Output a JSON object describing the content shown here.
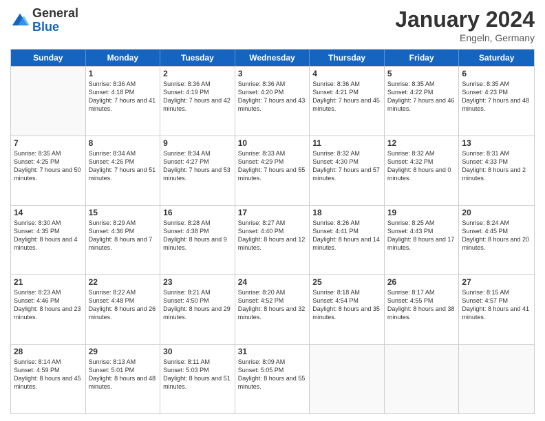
{
  "header": {
    "logo": {
      "line1": "General",
      "line2": "Blue"
    },
    "title": "January 2024",
    "subtitle": "Engeln, Germany"
  },
  "days": [
    "Sunday",
    "Monday",
    "Tuesday",
    "Wednesday",
    "Thursday",
    "Friday",
    "Saturday"
  ],
  "weeks": [
    [
      {
        "num": "",
        "empty": true
      },
      {
        "num": "1",
        "sunrise": "8:36 AM",
        "sunset": "4:18 PM",
        "daylight": "7 hours and 41 minutes."
      },
      {
        "num": "2",
        "sunrise": "8:36 AM",
        "sunset": "4:19 PM",
        "daylight": "7 hours and 42 minutes."
      },
      {
        "num": "3",
        "sunrise": "8:36 AM",
        "sunset": "4:20 PM",
        "daylight": "7 hours and 43 minutes."
      },
      {
        "num": "4",
        "sunrise": "8:36 AM",
        "sunset": "4:21 PM",
        "daylight": "7 hours and 45 minutes."
      },
      {
        "num": "5",
        "sunrise": "8:35 AM",
        "sunset": "4:22 PM",
        "daylight": "7 hours and 46 minutes."
      },
      {
        "num": "6",
        "sunrise": "8:35 AM",
        "sunset": "4:23 PM",
        "daylight": "7 hours and 48 minutes."
      }
    ],
    [
      {
        "num": "7",
        "sunrise": "8:35 AM",
        "sunset": "4:25 PM",
        "daylight": "7 hours and 50 minutes."
      },
      {
        "num": "8",
        "sunrise": "8:34 AM",
        "sunset": "4:26 PM",
        "daylight": "7 hours and 51 minutes."
      },
      {
        "num": "9",
        "sunrise": "8:34 AM",
        "sunset": "4:27 PM",
        "daylight": "7 hours and 53 minutes."
      },
      {
        "num": "10",
        "sunrise": "8:33 AM",
        "sunset": "4:29 PM",
        "daylight": "7 hours and 55 minutes."
      },
      {
        "num": "11",
        "sunrise": "8:32 AM",
        "sunset": "4:30 PM",
        "daylight": "7 hours and 57 minutes."
      },
      {
        "num": "12",
        "sunrise": "8:32 AM",
        "sunset": "4:32 PM",
        "daylight": "8 hours and 0 minutes."
      },
      {
        "num": "13",
        "sunrise": "8:31 AM",
        "sunset": "4:33 PM",
        "daylight": "8 hours and 2 minutes."
      }
    ],
    [
      {
        "num": "14",
        "sunrise": "8:30 AM",
        "sunset": "4:35 PM",
        "daylight": "8 hours and 4 minutes."
      },
      {
        "num": "15",
        "sunrise": "8:29 AM",
        "sunset": "4:36 PM",
        "daylight": "8 hours and 7 minutes."
      },
      {
        "num": "16",
        "sunrise": "8:28 AM",
        "sunset": "4:38 PM",
        "daylight": "8 hours and 9 minutes."
      },
      {
        "num": "17",
        "sunrise": "8:27 AM",
        "sunset": "4:40 PM",
        "daylight": "8 hours and 12 minutes."
      },
      {
        "num": "18",
        "sunrise": "8:26 AM",
        "sunset": "4:41 PM",
        "daylight": "8 hours and 14 minutes."
      },
      {
        "num": "19",
        "sunrise": "8:25 AM",
        "sunset": "4:43 PM",
        "daylight": "8 hours and 17 minutes."
      },
      {
        "num": "20",
        "sunrise": "8:24 AM",
        "sunset": "4:45 PM",
        "daylight": "8 hours and 20 minutes."
      }
    ],
    [
      {
        "num": "21",
        "sunrise": "8:23 AM",
        "sunset": "4:46 PM",
        "daylight": "8 hours and 23 minutes."
      },
      {
        "num": "22",
        "sunrise": "8:22 AM",
        "sunset": "4:48 PM",
        "daylight": "8 hours and 26 minutes."
      },
      {
        "num": "23",
        "sunrise": "8:21 AM",
        "sunset": "4:50 PM",
        "daylight": "8 hours and 29 minutes."
      },
      {
        "num": "24",
        "sunrise": "8:20 AM",
        "sunset": "4:52 PM",
        "daylight": "8 hours and 32 minutes."
      },
      {
        "num": "25",
        "sunrise": "8:18 AM",
        "sunset": "4:54 PM",
        "daylight": "8 hours and 35 minutes."
      },
      {
        "num": "26",
        "sunrise": "8:17 AM",
        "sunset": "4:55 PM",
        "daylight": "8 hours and 38 minutes."
      },
      {
        "num": "27",
        "sunrise": "8:15 AM",
        "sunset": "4:57 PM",
        "daylight": "8 hours and 41 minutes."
      }
    ],
    [
      {
        "num": "28",
        "sunrise": "8:14 AM",
        "sunset": "4:59 PM",
        "daylight": "8 hours and 45 minutes."
      },
      {
        "num": "29",
        "sunrise": "8:13 AM",
        "sunset": "5:01 PM",
        "daylight": "8 hours and 48 minutes."
      },
      {
        "num": "30",
        "sunrise": "8:11 AM",
        "sunset": "5:03 PM",
        "daylight": "8 hours and 51 minutes."
      },
      {
        "num": "31",
        "sunrise": "8:09 AM",
        "sunset": "5:05 PM",
        "daylight": "8 hours and 55 minutes."
      },
      {
        "num": "",
        "empty": true
      },
      {
        "num": "",
        "empty": true
      },
      {
        "num": "",
        "empty": true
      }
    ]
  ]
}
